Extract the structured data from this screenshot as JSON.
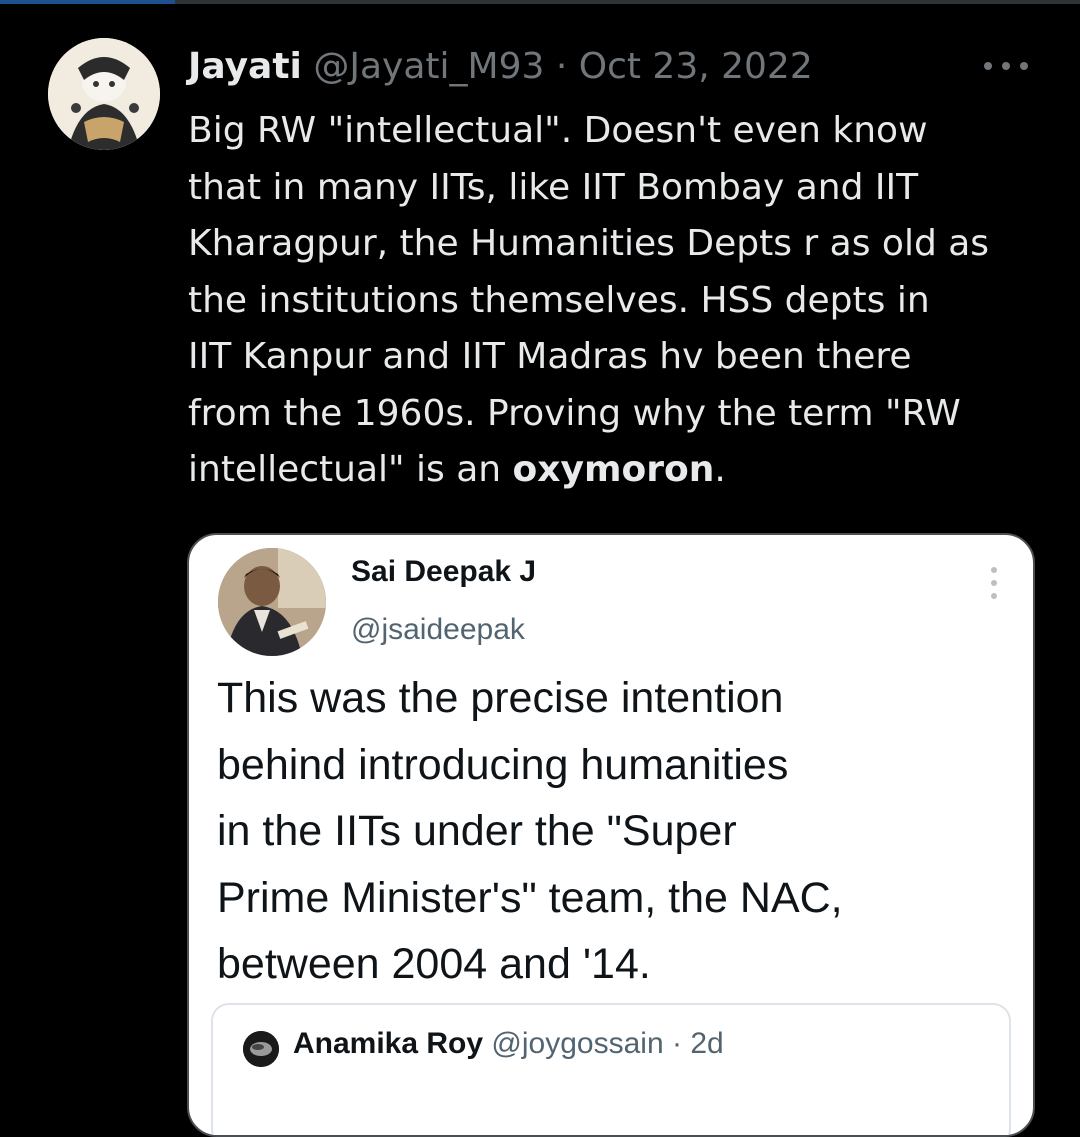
{
  "tweet": {
    "author_name": "Jayati",
    "author_handle": "@Jayati_M93",
    "separator": "·",
    "date": "Oct 23, 2022",
    "text_lines": [
      "Big RW \"intellectual\". Doesn't even know",
      "that in many IITs, like IIT Bombay and IIT",
      "Kharagpur, the Humanities Depts r as old as",
      "the institutions themselves. HSS depts in",
      "IIT Kanpur and IIT Madras hv been there",
      "from the 1960s. Proving why the term \"RW"
    ],
    "last_line_prefix": "intellectual\" is an ",
    "last_line_bold": "oxymoron",
    "last_line_suffix": "."
  },
  "quoted_tweet": {
    "author_name": "Sai Deepak J",
    "author_handle": "@jsaideepak",
    "text_lines": [
      "This was the precise intention",
      "behind introducing humanities",
      "in the IITs under the \"Super",
      "Prime Minister's\" team, the NAC,",
      "between 2004 and '14."
    ],
    "nested": {
      "author_name": "Anamika Roy",
      "author_handle": "@joygossain",
      "separator": "·",
      "time": "2d"
    }
  },
  "icons": {
    "main_more": "more-horizontal-icon",
    "quote_more": "more-vertical-icon"
  },
  "colors": {
    "background": "#000000",
    "text": "#e7e9ea",
    "muted": "#71767b",
    "quote_bg": "#ffffff"
  }
}
